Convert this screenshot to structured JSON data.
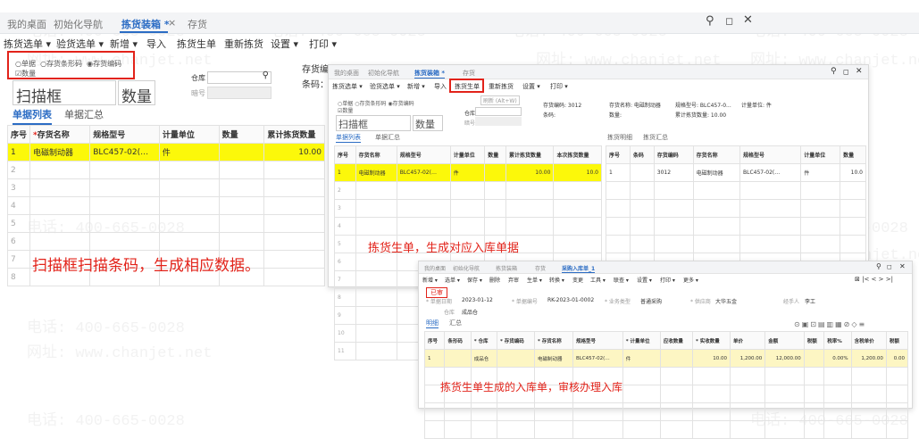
{
  "watermark": {
    "phone": "电话: 400-665-0028",
    "site": "网址: www.chanjet.net"
  },
  "main": {
    "tabs": [
      "我的桌面",
      "初始化导航",
      "拣货装箱 *",
      "存货"
    ],
    "close_x": "×",
    "toolbar": [
      "拣货选单 ▾",
      "验货选单 ▾",
      "新增 ▾",
      "导入",
      "拣货生单",
      "重新拣货",
      "设置 ▾",
      "打印 ▾"
    ],
    "radios": [
      "单据",
      "存货条形码",
      "存货编码"
    ],
    "checkbox": "数量",
    "scan_label": "扫描框",
    "qty_label": "数量",
    "warehouse_label": "仓库",
    "code_label": "暗号",
    "info_label": "存货编码：3012",
    "bar_label": "条码：",
    "subtabs": [
      "单据列表",
      "单据汇总"
    ],
    "columns": [
      "序号",
      "存货名称",
      "规格型号",
      "计量单位",
      "数量",
      "累计拣货数量"
    ],
    "row": [
      "1",
      "电磁制动器",
      "BLC457-02(…",
      "件",
      "",
      "10.00"
    ],
    "row_nums": [
      "2",
      "3",
      "4",
      "5",
      "6",
      "7",
      "8"
    ],
    "caption": "扫描框扫描条码，生成相应数据。"
  },
  "window2": {
    "tabs": [
      "我的桌面",
      "初始化导航",
      "拣货装箱 *",
      "存货"
    ],
    "toolbar": [
      "拣货选单 ▾",
      "验货选单 ▾",
      "新增 ▾",
      "导入",
      "拣货生单",
      "重新拣货",
      "设置 ▾",
      "打印 ▾"
    ],
    "hint": "刷新 (Alt+W)",
    "radios": [
      "单据",
      "存货条形码",
      "存货编码"
    ],
    "checkbox": "数量",
    "scan_label": "扫描框",
    "qty_label": "数量",
    "warehouse_label": "仓库",
    "code_label": "暗号",
    "info": [
      "存货编码: 3012",
      "存货名称: 电磁制动器",
      "规格型号: BLC457-0...",
      "计量单位: 件",
      "条码:",
      "数量:",
      "累计拣货数量: 10.00"
    ],
    "subtabs": [
      "单据列表",
      "单据汇总"
    ],
    "subtabs_r": [
      "拣货明细",
      "拣货汇总"
    ],
    "columns_l": [
      "序号",
      "存货名称",
      "规格型号",
      "计量单位",
      "数量",
      "累计拣货数量",
      "本次拣货数量"
    ],
    "row_l": [
      "1",
      "电磁制动器",
      "BLC457-02(…",
      "件",
      "",
      "10.00",
      "10.0"
    ],
    "columns_r": [
      "序号",
      "条码",
      "存货编码",
      "存货名称",
      "规格型号",
      "计量单位",
      "数量"
    ],
    "row_r": [
      "1",
      "",
      "3012",
      "电磁制动器",
      "BLC457-02(…",
      "件",
      "10.0"
    ],
    "row_nums": [
      "2",
      "3",
      "4",
      "5",
      "6",
      "7",
      "8",
      "9",
      "10",
      "11"
    ],
    "caption": "拣货生单，生成对应入库单据"
  },
  "window3": {
    "tabs": [
      "我的桌面",
      "初始化导航",
      "拣货装箱",
      "存货",
      "采购入库单_1"
    ],
    "toolbar": [
      "新增 ▾",
      "选单 ▾",
      "保存 ▾",
      "删除",
      "弃审",
      "生单 ▾",
      "转换 ▾",
      "变更",
      "工具 ▾",
      "联查 ▾",
      "设置 ▾",
      "打印 ▾",
      "更多 ▾"
    ],
    "stamp": "已审",
    "fields": [
      [
        "* 单据日期",
        "2023-01-12"
      ],
      [
        "* 单据编号",
        "RK-2023-01-0002"
      ],
      [
        "* 业务类型",
        "普通采购"
      ],
      [
        "* 供应商",
        "大华五金"
      ],
      [
        "经手人",
        "李工"
      ]
    ],
    "warehouse": [
      "仓库",
      "成品仓"
    ],
    "subtabs": [
      "明细",
      "汇总"
    ],
    "columns": [
      "序号",
      "条形码",
      "* 仓库",
      "* 存货编码",
      "* 存货名称",
      "规格型号",
      "* 计量单位",
      "应收数量",
      "* 实收数量",
      "单价",
      "金额",
      "税额",
      "税率%",
      "含税单价",
      "税额"
    ],
    "row": [
      "1",
      "",
      "成品仓",
      "",
      "电磁制动器",
      "BLC457-02(…",
      "件",
      "",
      "10.00",
      "1,200.00",
      "12,000.00",
      "",
      "0.00%",
      "1,200.00",
      "0.00"
    ],
    "caption": "拣货生单生成的入库单，审核办理入库"
  }
}
